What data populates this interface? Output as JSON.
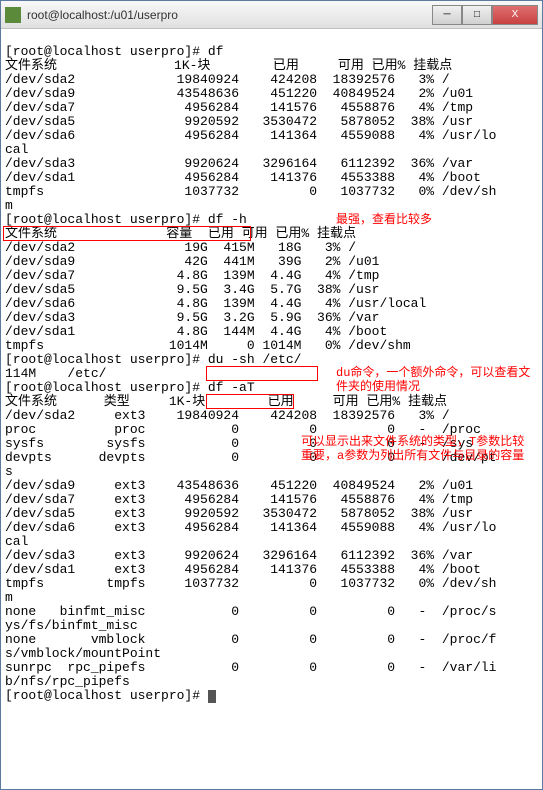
{
  "window": {
    "title": "root@localhost:/u01/userpro",
    "min_label": "─",
    "max_label": "□",
    "close_label": "X"
  },
  "prompt": "[root@localhost userpro]# ",
  "commands": {
    "df": "df",
    "df_h": "df -h",
    "du_sh": "du -sh /etc/",
    "df_aT": "df -aT"
  },
  "annotations": {
    "a1": "最强，查看比较多",
    "a2": "du命令，一个额外命令，可以查看文件夹的使用情况",
    "a3": "可以显示出来文件系统的类型，T参数比较重要，a参数为列出所有文件与目录的容量"
  },
  "df1_header": "文件系统               1K-块        已用     可用 已用% 挂载点",
  "df1": [
    "/dev/sda2             19840924    424208  18392576   3% /",
    "/dev/sda9             43548636    451220  40849524   2% /u01",
    "/dev/sda7              4956284    141576   4558876   4% /tmp",
    "/dev/sda5              9920592   3530472   5878052  38% /usr",
    "/dev/sda6              4956284    141364   4559088   4% /usr/lo",
    "cal",
    "/dev/sda3              9920624   3296164   6112392  36% /var",
    "/dev/sda1              4956284    141376   4553388   4% /boot",
    "tmpfs                  1037732         0   1037732   0% /dev/sh",
    "m"
  ],
  "dfh_header": "文件系统              容量  已用 可用 已用% 挂载点",
  "dfh": [
    "/dev/sda2              19G  415M   18G   3% /",
    "/dev/sda9              42G  441M   39G   2% /u01",
    "/dev/sda7             4.8G  139M  4.4G   4% /tmp",
    "/dev/sda5             9.5G  3.4G  5.7G  38% /usr",
    "/dev/sda6             4.8G  139M  4.4G   4% /usr/local",
    "/dev/sda3             9.5G  3.2G  5.9G  36% /var",
    "/dev/sda1             4.8G  144M  4.4G   4% /boot",
    "tmpfs                1014M     0 1014M   0% /dev/shm"
  ],
  "du_out": "114M    /etc/",
  "dfaT_header": "文件系统      类型     1K-块        已用     可用 已用% 挂载点",
  "dfaT": [
    "/dev/sda2     ext3    19840924    424208  18392576   3% /",
    "proc          proc           0         0         0   -  /proc",
    "sysfs        sysfs           0         0         0   -  /sys",
    "devpts      devpts           0         0         0   -  /dev/pt",
    "s",
    "/dev/sda9     ext3    43548636    451220  40849524   2% /u01",
    "/dev/sda7     ext3     4956284    141576   4558876   4% /tmp",
    "/dev/sda5     ext3     9920592   3530472   5878052  38% /usr",
    "/dev/sda6     ext3     4956284    141364   4559088   4% /usr/lo",
    "cal",
    "/dev/sda3     ext3     9920624   3296164   6112392  36% /var",
    "/dev/sda1     ext3     4956284    141376   4553388   4% /boot",
    "tmpfs        tmpfs     1037732         0   1037732   0% /dev/sh",
    "m",
    "none   binfmt_misc           0         0         0   -  /proc/s",
    "ys/fs/binfmt_misc",
    "none       vmblock           0         0         0   -  /proc/f",
    "s/vmblock/mountPoint",
    "sunrpc  rpc_pipefs           0         0         0   -  /var/li",
    "b/nfs/rpc_pipefs"
  ]
}
